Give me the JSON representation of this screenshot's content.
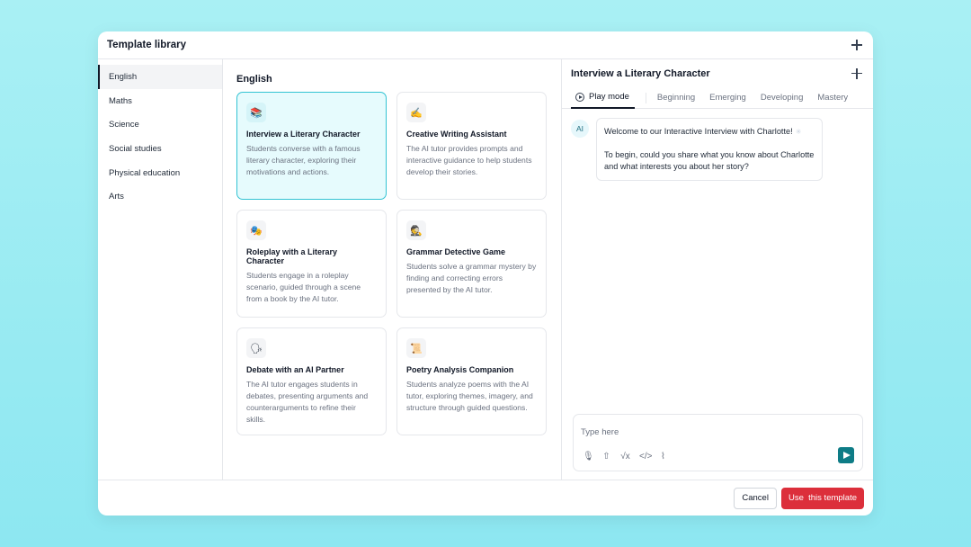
{
  "modal": {
    "title": "Template library"
  },
  "sidebar": {
    "items": [
      {
        "label": "English"
      },
      {
        "label": "Maths"
      },
      {
        "label": "Science"
      },
      {
        "label": "Social studies"
      },
      {
        "label": "Physical education"
      },
      {
        "label": "Arts"
      }
    ],
    "active_index": 0
  },
  "center": {
    "heading": "English",
    "cards": [
      {
        "icon": "📚",
        "icon_name": "books-icon",
        "title": "Interview a Literary Character",
        "desc": "Students converse with a famous literary character, exploring their motivations and actions."
      },
      {
        "icon": "✍",
        "icon_name": "writing-hand-icon",
        "title": "Creative Writing Assistant",
        "desc": "The AI tutor provides prompts and interactive guidance to help students develop their stories."
      },
      {
        "icon": "🎭",
        "icon_name": "theater-masks-icon",
        "title": "Roleplay with a Literary Character",
        "desc": "Students engage in a roleplay scenario, guided through a scene from a book by the AI tutor."
      },
      {
        "icon": "🕵",
        "icon_name": "detective-icon",
        "title": "Grammar Detective Game",
        "desc": "Students solve a grammar mystery by finding and correcting errors presented by the AI tutor."
      },
      {
        "icon": "🗣",
        "icon_name": "speaking-head-icon",
        "title": "Debate with an AI Partner",
        "desc": "The AI tutor engages students in debates, presenting arguments and counterarguments to refine their skills."
      },
      {
        "icon": "📜",
        "icon_name": "scroll-icon",
        "title": "Poetry Analysis Companion",
        "desc": "Students analyze poems with the AI tutor, exploring themes, imagery, and structure through guided questions."
      }
    ]
  },
  "preview": {
    "title": "Interview a Literary Character",
    "tabs": {
      "play_mode": "Play mode",
      "beginning": "Beginning",
      "emerging": "Emerging",
      "developing": "Developing",
      "mastery": "Mastery"
    },
    "chat": {
      "avatar_label": "AI",
      "message_line1": "Welcome to our Interactive Interview with Charlotte!",
      "message_line2": "To begin, could you share what you know about Charlotte and what interests you about her story?"
    },
    "composer": {
      "placeholder": "Type here",
      "tools": [
        "microphone-icon",
        "upload-icon",
        "formula-icon",
        "code-icon",
        "chart-icon"
      ]
    }
  },
  "footer": {
    "cancel_label": "Cancel",
    "use_label": "Use  this template"
  },
  "colors": {
    "accent": "#0e7c86",
    "primary_button": "#dc2f3b",
    "selected_card_bg": "#e6fbfd",
    "selected_card_border": "#33c3d3"
  }
}
